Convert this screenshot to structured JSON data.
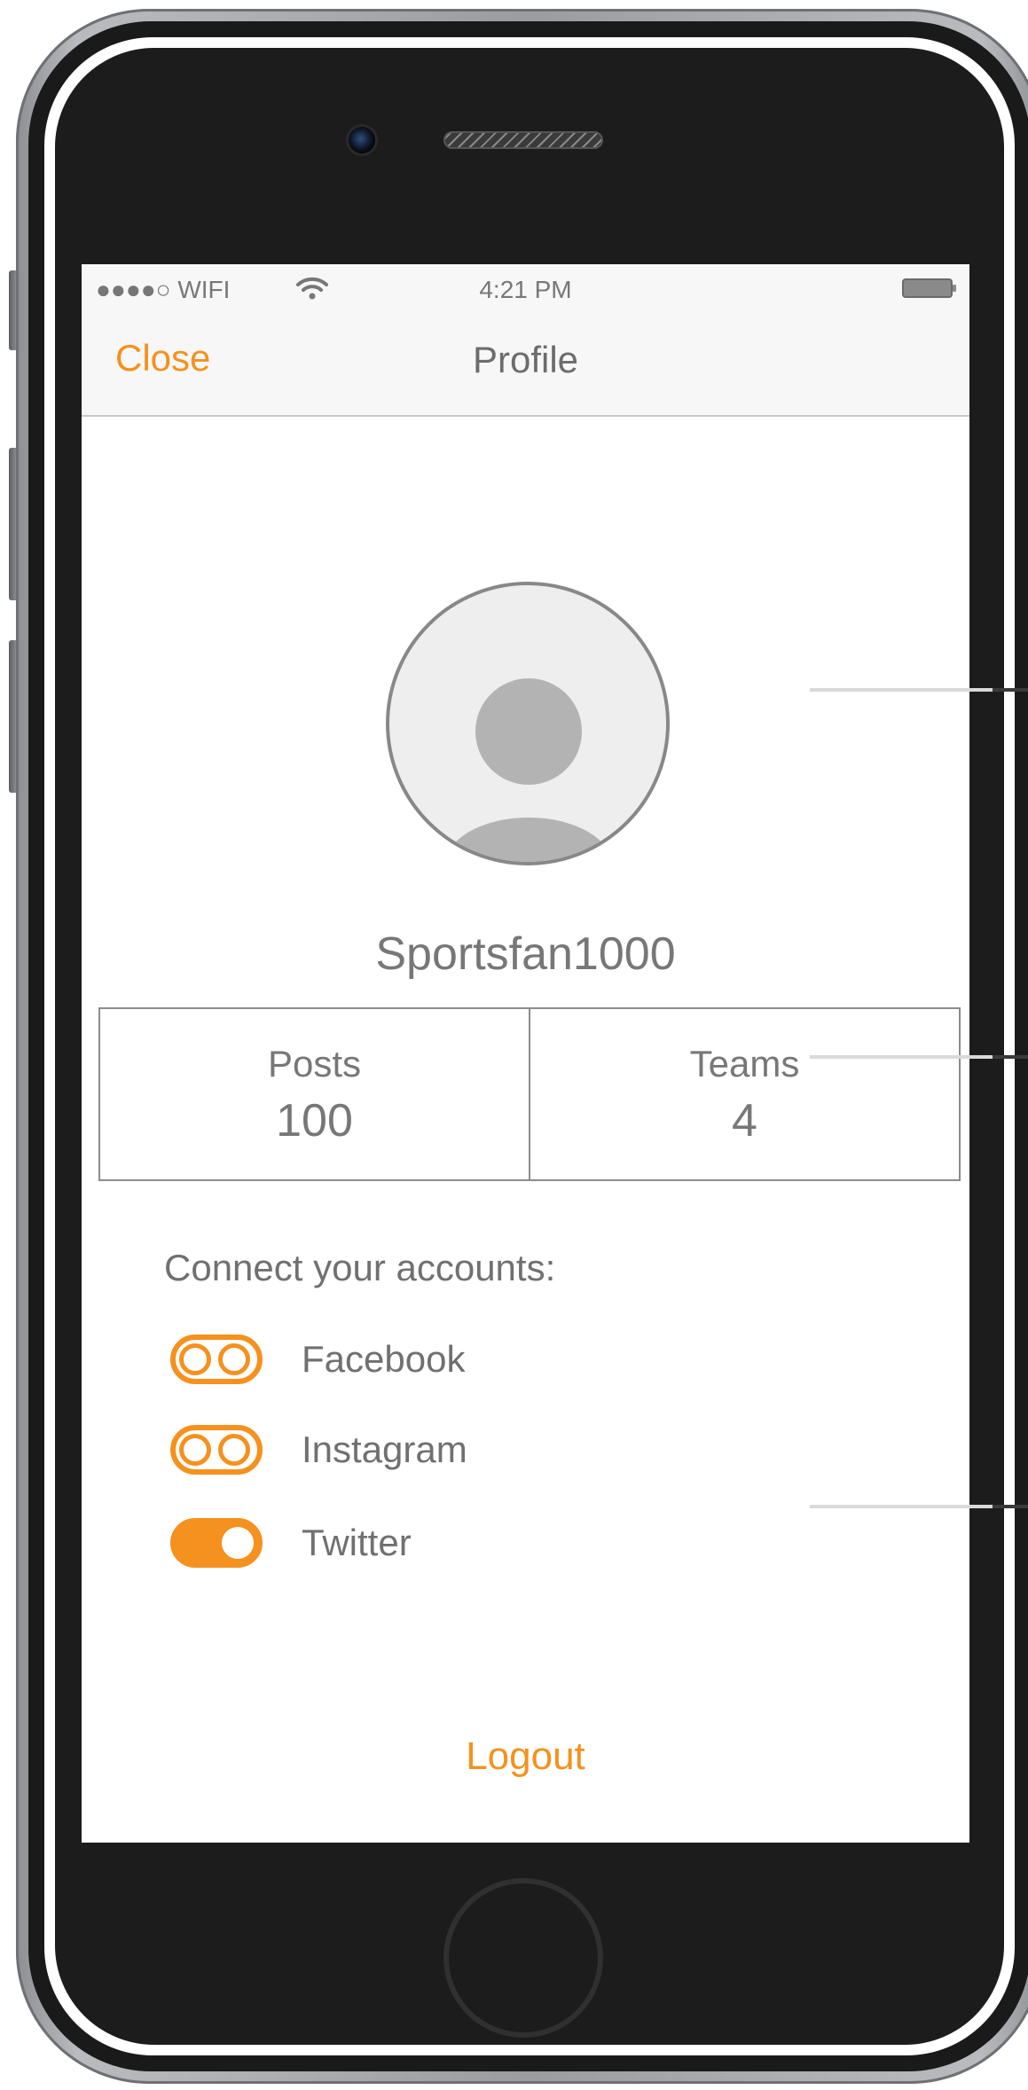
{
  "status_bar": {
    "carrier": "●●●●○ WIFI",
    "time": "4:21 PM",
    "wifi_icon": "wifi-icon",
    "battery_icon": "battery-icon"
  },
  "nav": {
    "close_label": "Close",
    "title": "Profile"
  },
  "profile": {
    "avatar_icon": "user-avatar-icon",
    "username": "Sportsfan1000",
    "stats": [
      {
        "label": "Posts",
        "value": "100"
      },
      {
        "label": "Teams",
        "value": "4"
      }
    ]
  },
  "accounts": {
    "heading": "Connect your accounts:",
    "items": [
      {
        "label": "Facebook",
        "connected": false
      },
      {
        "label": "Instagram",
        "connected": false
      },
      {
        "label": "Twitter",
        "connected": true
      }
    ]
  },
  "footer": {
    "logout_label": "Logout"
  },
  "colors": {
    "accent": "#f5911e",
    "text": "#707070",
    "nav_background": "#f7f7f7"
  }
}
